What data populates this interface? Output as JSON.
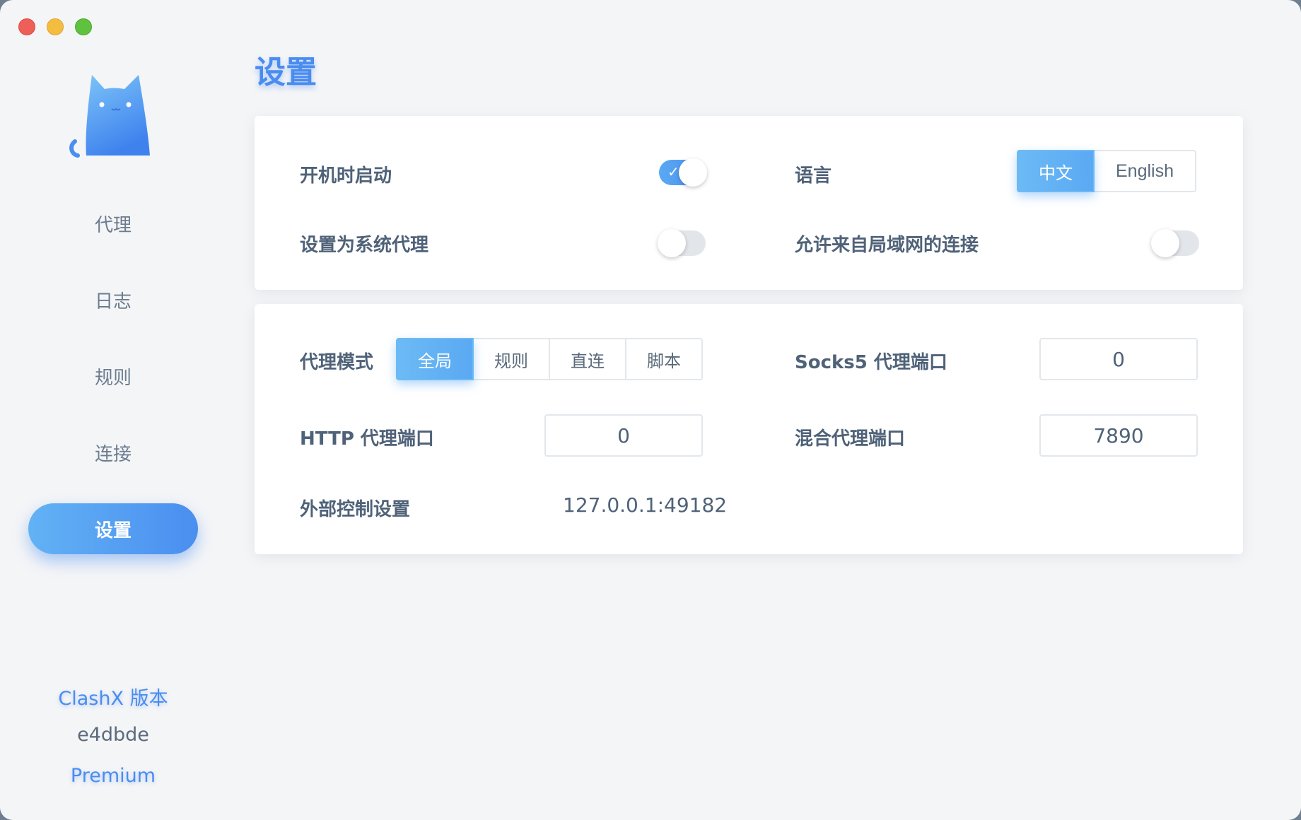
{
  "window": {
    "controls": {
      "close": "close",
      "minimize": "minimize",
      "zoom": "zoom"
    }
  },
  "sidebar": {
    "logo_icon": "cat-logo-icon",
    "items": [
      {
        "label": "代理",
        "active": false
      },
      {
        "label": "日志",
        "active": false
      },
      {
        "label": "规则",
        "active": false
      },
      {
        "label": "连接",
        "active": false
      },
      {
        "label": "设置",
        "active": true
      }
    ],
    "version_title": "ClashX 版本",
    "version_hash": "e4dbde",
    "version_edition": "Premium"
  },
  "main": {
    "title": "设置",
    "general": {
      "launch_at_login": {
        "label": "开机时启动",
        "enabled": true
      },
      "language": {
        "label": "语言",
        "options": [
          "中文",
          "English"
        ],
        "selected": "中文"
      },
      "system_proxy": {
        "label": "设置为系统代理",
        "enabled": false
      },
      "allow_lan": {
        "label": "允许来自局域网的连接",
        "enabled": false
      }
    },
    "proxy": {
      "mode": {
        "label": "代理模式",
        "options": [
          "全局",
          "规则",
          "直连",
          "脚本"
        ],
        "selected": "全局"
      },
      "socks5_port": {
        "label": "Socks5 代理端口",
        "value": "0"
      },
      "http_port": {
        "label": "HTTP 代理端口",
        "value": "0"
      },
      "mixed_port": {
        "label": "混合代理端口",
        "value": "7890"
      },
      "external_controller": {
        "label": "外部控制设置",
        "value": "127.0.0.1:49182"
      }
    }
  },
  "colors": {
    "accent": "#4a8cf0",
    "accent_light": "#5aa9f3",
    "text": "#4f6278",
    "background": "#f4f5f7"
  }
}
